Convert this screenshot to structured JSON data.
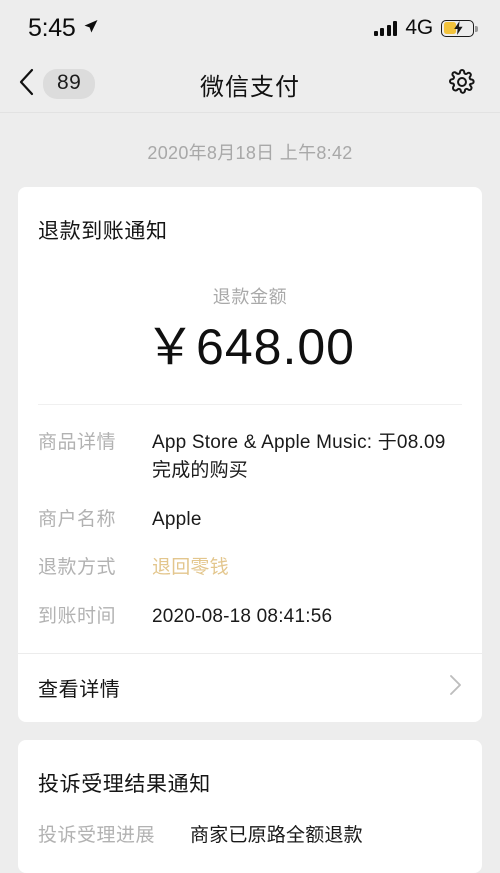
{
  "status_bar": {
    "time": "5:45",
    "location_icon": "location-arrow-icon",
    "signal_icon": "cellular-signal-icon",
    "carrier": "4G",
    "battery_icon": "battery-charging-icon",
    "battery_color": "#f2c33c"
  },
  "nav": {
    "back_icon": "chevron-left-icon",
    "back_badge": "89",
    "title": "微信支付",
    "settings_icon": "gear-icon"
  },
  "date_stamp": "2020年8月18日 上午8:42",
  "refund_card": {
    "title": "退款到账通知",
    "amount_label": "退款金额",
    "amount_value": "￥648.00",
    "rows": [
      {
        "label": "商品详情",
        "value": "App Store & Apple Music: 于08.09完成的购买"
      },
      {
        "label": "商户名称",
        "value": "Apple"
      },
      {
        "label": "退款方式",
        "value": "退回零钱",
        "color": "#e3c68d"
      },
      {
        "label": "到账时间",
        "value": "2020-08-18 08:41:56"
      }
    ],
    "footer_label": "查看详情",
    "footer_icon": "chevron-right-icon"
  },
  "complaint_card": {
    "title": "投诉受理结果通知",
    "rows": [
      {
        "label": "投诉受理进展",
        "value": "商家已原路全额退款"
      }
    ]
  }
}
